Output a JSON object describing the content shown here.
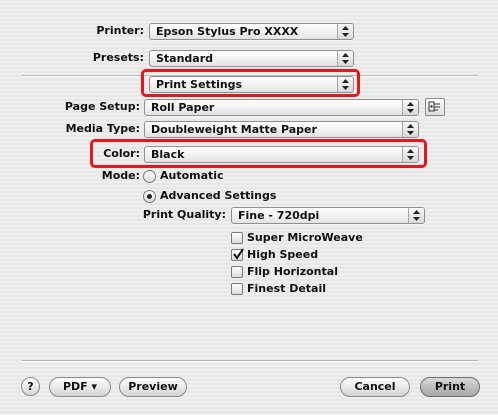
{
  "printer": {
    "label": "Printer:",
    "value": "Epson Stylus Pro XXXX"
  },
  "presets": {
    "label": "Presets:",
    "value": "Standard"
  },
  "panel": {
    "value": "Print Settings"
  },
  "page_setup": {
    "label": "Page Setup:",
    "value": "Roll Paper"
  },
  "media_type": {
    "label": "Media Type:",
    "value": "Doubleweight Matte Paper"
  },
  "color": {
    "label": "Color:",
    "value": "Black"
  },
  "mode": {
    "label": "Mode:",
    "automatic": "Automatic",
    "advanced": "Advanced Settings",
    "selected": "Advanced Settings"
  },
  "print_quality": {
    "label": "Print Quality:",
    "value": "Fine - 720dpi"
  },
  "options": [
    {
      "label": "Super MicroWeave",
      "checked": false
    },
    {
      "label": "High Speed",
      "checked": true
    },
    {
      "label": "Flip Horizontal",
      "checked": false
    },
    {
      "label": "Finest Detail",
      "checked": false
    }
  ],
  "buttons": {
    "help": "?",
    "pdf": "PDF ▾",
    "preview": "Preview",
    "cancel": "Cancel",
    "print": "Print"
  },
  "highlight_color": "#e8151b"
}
